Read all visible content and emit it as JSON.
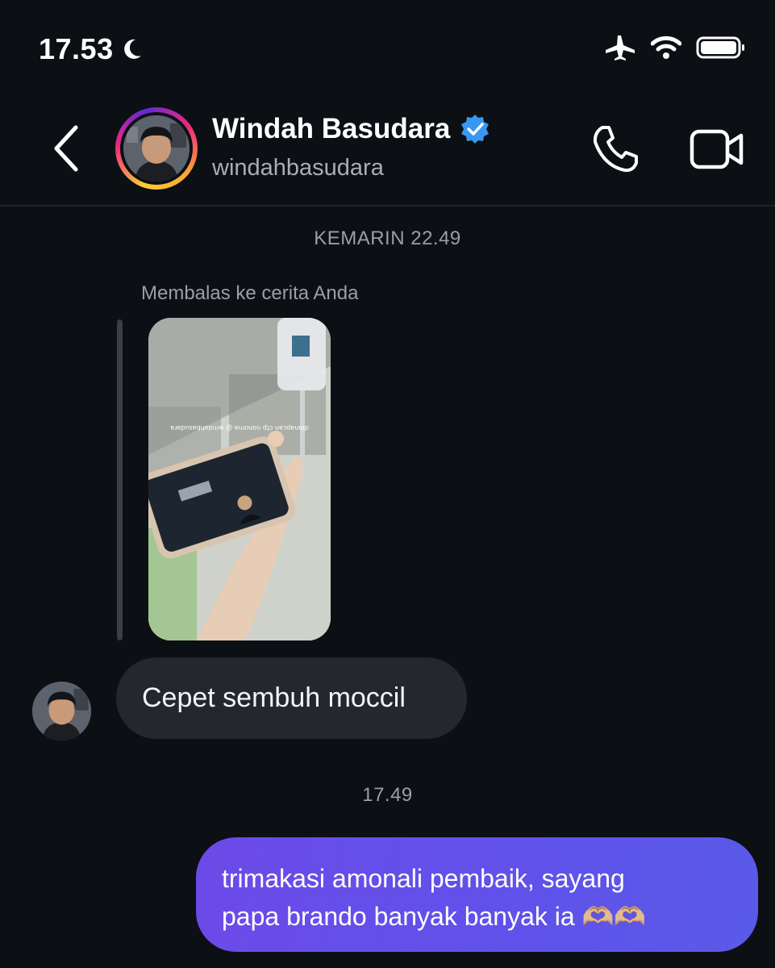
{
  "status_bar": {
    "time": "17.53"
  },
  "header": {
    "contact_name": "Windah Basudara",
    "contact_handle": "windahbasudara",
    "verified": true
  },
  "thread": {
    "timestamp_1": "KEMARIN 22.49",
    "reply_label": "Membalas ke cerita Anda",
    "story_caption": "dibnapcan ctp nonoma @ windahbasudara",
    "incoming_message": "Cepet sembuh moccil",
    "timestamp_2": "17.49",
    "outgoing_line_1": "trimakasi amonali pembaik, sayang",
    "outgoing_line_2": "papa brando banyak banyak ia 🫶🏼🫶🏼"
  },
  "colors": {
    "background": "#0c0f14",
    "incoming_bubble": "#24272e",
    "outgoing_bubble": "#5f52ea",
    "verified_badge": "#3897f0"
  },
  "icons": [
    "moon-icon",
    "airplane-icon",
    "wifi-icon",
    "battery-icon",
    "back-icon",
    "verified-badge-icon",
    "phone-icon",
    "video-camera-icon"
  ]
}
